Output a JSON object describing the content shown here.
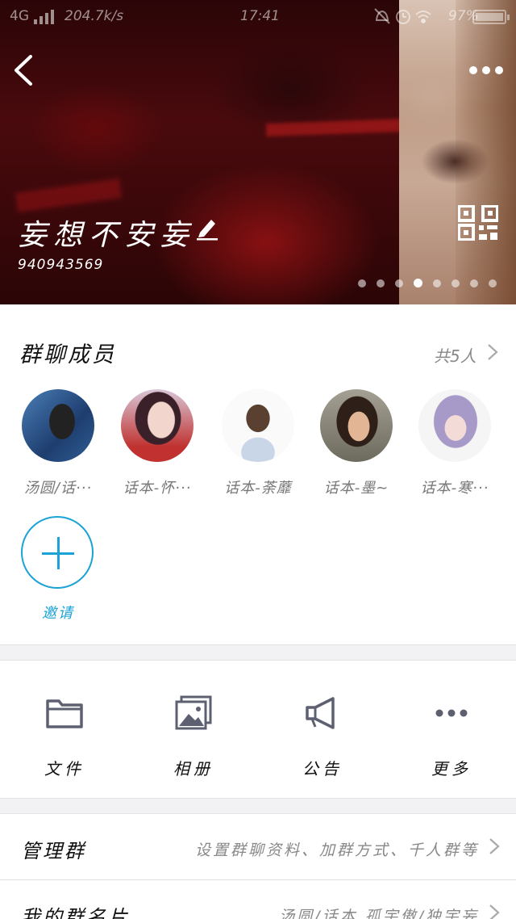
{
  "status_bar": {
    "network": "4G",
    "speed": "204.7k/s",
    "time": "17:41",
    "battery": "97%"
  },
  "header": {
    "group_name": "妄想不安妄",
    "group_id": "940943569",
    "page_count": 8,
    "active_page": 4,
    "icons": [
      "back-arrow-icon",
      "more-dots-icon",
      "edit-pencil-icon",
      "qr-code-icon"
    ]
  },
  "members": {
    "title": "群聊成员",
    "count_label": "共5人",
    "list": [
      {
        "name": "汤圆/话···",
        "avatar": "avatar-singer"
      },
      {
        "name": "话本-怀···",
        "avatar": "avatar-girl-red"
      },
      {
        "name": "话本-荼蘼",
        "avatar": "avatar-floral-hair"
      },
      {
        "name": "话本-墨~",
        "avatar": "avatar-girl-dark-hair"
      },
      {
        "name": "话本-寒···",
        "avatar": "avatar-purple-hair"
      }
    ],
    "invite_label": "邀请"
  },
  "tools": [
    {
      "label": "文件",
      "icon": "folder-icon"
    },
    {
      "label": "相册",
      "icon": "photo-album-icon"
    },
    {
      "label": "公告",
      "icon": "megaphone-icon"
    },
    {
      "label": "更多",
      "icon": "more-dots-icon"
    }
  ],
  "settings": [
    {
      "label": "管理群",
      "value": "设置群聊资料、加群方式、千人群等"
    },
    {
      "label": "我的群名片",
      "value": "汤圆/话本 孤宇傲/独宇妄"
    }
  ],
  "colors": {
    "accent": "#1ba3d6",
    "header_red": "#4a0a0d",
    "icon_gray": "#5d6070"
  }
}
